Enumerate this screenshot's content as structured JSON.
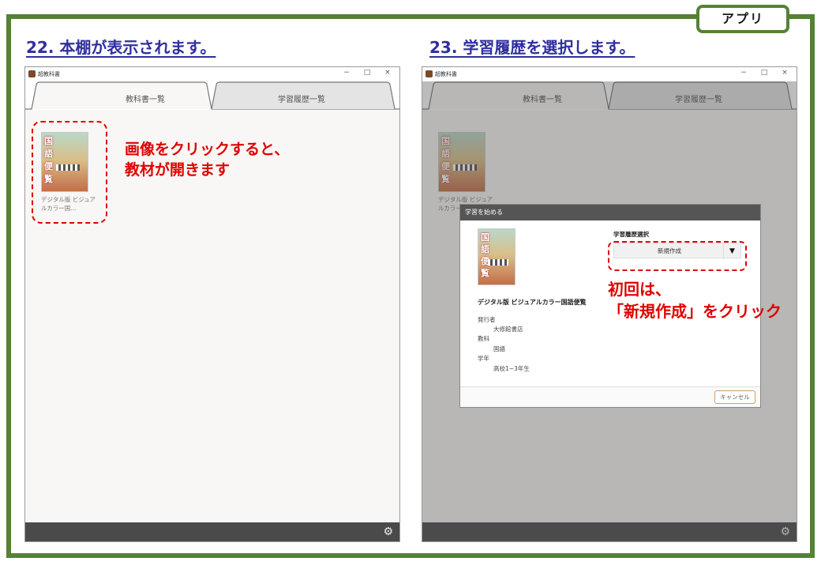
{
  "badge": "アプリ",
  "steps": {
    "left_title": "22. 本棚が表示されます。",
    "right_title": "23. 学習履歴を選択します。"
  },
  "window": {
    "app_name": "超教科書",
    "controls": {
      "minimize": "−",
      "maximize": "□",
      "close": "×"
    },
    "tabs": [
      "教科書一覧",
      "学習履歴一覧"
    ],
    "settings_icon": "⚙"
  },
  "book": {
    "cover_chars": [
      "国",
      "語",
      "便",
      "覧"
    ],
    "caption": "デジタル版 ビジュアルカラー国..."
  },
  "left_note": [
    "画像をクリックすると、",
    "教材が開きます"
  ],
  "dialog": {
    "title": "学習を始める",
    "book_title": "デジタル版 ビジュアルカラー国語便覧",
    "fields": [
      {
        "label": "発行者",
        "value": "大修館書店"
      },
      {
        "label": "教科",
        "value": "国語"
      },
      {
        "label": "学年",
        "value": "高校1−3年生"
      }
    ],
    "select_label": "学習履歴選択",
    "select_value": "新規作成",
    "select_arrow": "▼",
    "cancel": "キャンセル"
  },
  "right_note": [
    "初回は、",
    "「新規作成」をクリック"
  ],
  "colors": {
    "frame": "#548235",
    "title": "#2f2fa0",
    "annotation": "#e00000",
    "bar": "#4a4a4a"
  }
}
